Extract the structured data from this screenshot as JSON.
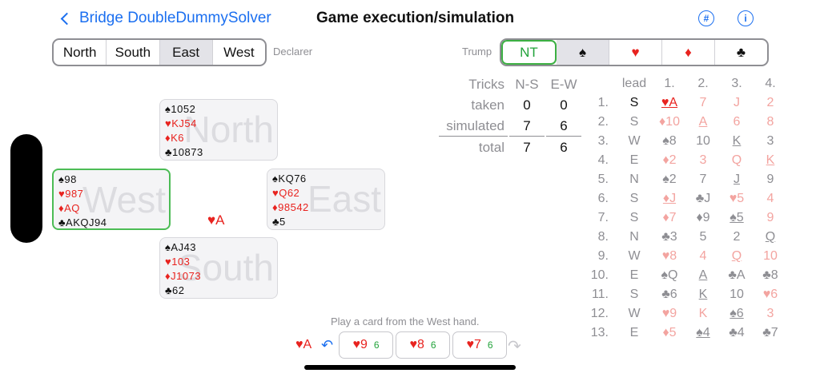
{
  "header": {
    "back_label": "Bridge DoubleDummySolver",
    "title": "Game execution/simulation",
    "hash_icon": "#",
    "info_icon": "i"
  },
  "declarer": {
    "options": [
      "North",
      "South",
      "East",
      "West"
    ],
    "selected": "East",
    "label": "Declarer"
  },
  "trump": {
    "label": "Trump",
    "options": [
      "NT",
      "♠",
      "♥",
      "♦",
      "♣"
    ],
    "selected": "♠"
  },
  "hands": {
    "north": {
      "name": "North",
      "spades": "♠1052",
      "hearts": "♥KJ54",
      "diamonds": "♦K6",
      "clubs": "♣10873"
    },
    "west": {
      "name": "West",
      "spades": "♠98",
      "hearts": "♥987",
      "diamonds": "♦AQ",
      "clubs": "♣AKQJ94"
    },
    "east": {
      "name": "East",
      "spades": "♠KQ76",
      "hearts": "♥Q62",
      "diamonds": "♦98542",
      "clubs": "♣5"
    },
    "south": {
      "name": "South",
      "spades": "♠AJ43",
      "hearts": "♥103",
      "diamonds": "♦J1073",
      "clubs": "♣62"
    }
  },
  "played_card": "♥A",
  "summary": {
    "col_tricks": "Tricks",
    "col_ns": "N-S",
    "col_ew": "E-W",
    "rows": [
      {
        "label": "taken",
        "ns": "0",
        "ew": "0"
      },
      {
        "label": "simulated",
        "ns": "7",
        "ew": "6"
      },
      {
        "label": "total",
        "ns": "7",
        "ew": "6"
      }
    ]
  },
  "record": {
    "headers": [
      "lead",
      "1.",
      "2.",
      "3.",
      "4."
    ],
    "rows": [
      {
        "no": "1.",
        "lead": "S",
        "cards": [
          "♥A",
          "7",
          "J",
          "2"
        ]
      },
      {
        "no": "2.",
        "lead": "S",
        "cards": [
          "♦10",
          "A",
          "6",
          "8"
        ]
      },
      {
        "no": "3.",
        "lead": "W",
        "cards": [
          "♠8",
          "10",
          "K",
          "3"
        ]
      },
      {
        "no": "4.",
        "lead": "E",
        "cards": [
          "♦2",
          "3",
          "Q",
          "K"
        ]
      },
      {
        "no": "5.",
        "lead": "N",
        "cards": [
          "♠2",
          "7",
          "J",
          "9"
        ]
      },
      {
        "no": "6.",
        "lead": "S",
        "cards": [
          "♦J",
          "♣J",
          "♥5",
          "4"
        ]
      },
      {
        "no": "7.",
        "lead": "S",
        "cards": [
          "♦7",
          "♦9",
          "♠5",
          "9"
        ]
      },
      {
        "no": "8.",
        "lead": "N",
        "cards": [
          "♣3",
          "5",
          "2",
          "Q"
        ]
      },
      {
        "no": "9.",
        "lead": "W",
        "cards": [
          "♥8",
          "4",
          "Q",
          "10"
        ]
      },
      {
        "no": "10.",
        "lead": "E",
        "cards": [
          "♠Q",
          "A",
          "♣A",
          "♣8"
        ]
      },
      {
        "no": "11.",
        "lead": "S",
        "cards": [
          "♣6",
          "K",
          "10",
          "♥6"
        ]
      },
      {
        "no": "12.",
        "lead": "W",
        "cards": [
          "♥9",
          "K",
          "♠6",
          "3"
        ]
      },
      {
        "no": "13.",
        "lead": "E",
        "cards": [
          "♦5",
          "♠4",
          "♣4",
          "♣7"
        ]
      }
    ]
  },
  "footer": {
    "instruction": "Play a card from the West hand.",
    "last_card": "♥A",
    "choices": [
      {
        "card": "♥9",
        "count": "6"
      },
      {
        "card": "♥8",
        "count": "6"
      },
      {
        "card": "♥7",
        "count": "6"
      }
    ]
  }
}
